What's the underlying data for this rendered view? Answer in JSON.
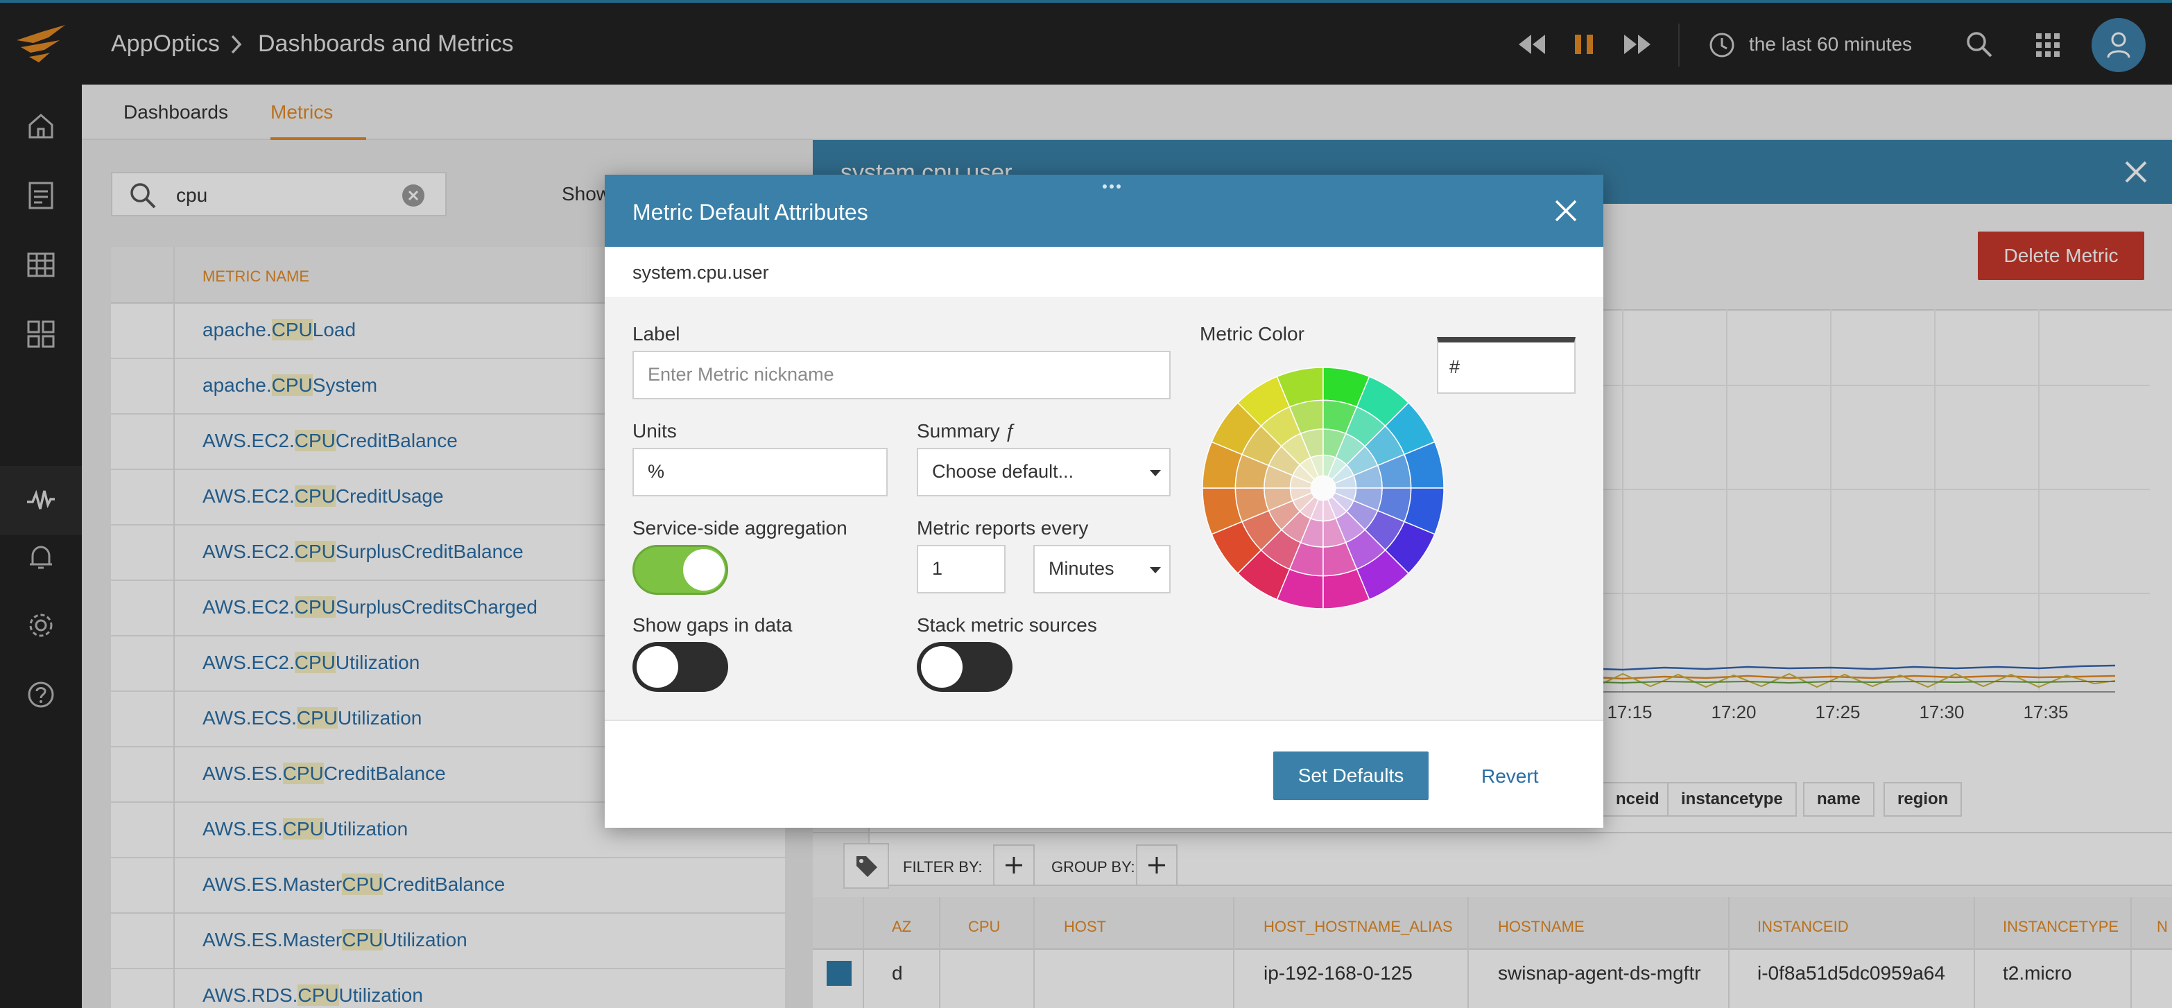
{
  "header": {
    "app_name": "AppOptics",
    "page_title": "Dashboards and Metrics",
    "time_range": "the last 60 minutes"
  },
  "subnav": {
    "tabs": [
      {
        "label": "Dashboards",
        "active": false
      },
      {
        "label": "Metrics",
        "active": true
      }
    ]
  },
  "search": {
    "value": "cpu",
    "show_label": "Show"
  },
  "metrics_table": {
    "column_header": "METRIC NAME",
    "rows": [
      {
        "prefix": "apache.",
        "match": "CPU",
        "suffix": "Load"
      },
      {
        "prefix": "apache.",
        "match": "CPU",
        "suffix": "System"
      },
      {
        "prefix": "AWS.EC2.",
        "match": "CPU",
        "suffix": "CreditBalance"
      },
      {
        "prefix": "AWS.EC2.",
        "match": "CPU",
        "suffix": "CreditUsage"
      },
      {
        "prefix": "AWS.EC2.",
        "match": "CPU",
        "suffix": "SurplusCreditBalance"
      },
      {
        "prefix": "AWS.EC2.",
        "match": "CPU",
        "suffix": "SurplusCreditsCharged"
      },
      {
        "prefix": "AWS.EC2.",
        "match": "CPU",
        "suffix": "Utilization"
      },
      {
        "prefix": "AWS.ECS.",
        "match": "CPU",
        "suffix": "Utilization"
      },
      {
        "prefix": "AWS.ES.",
        "match": "CPU",
        "suffix": "CreditBalance"
      },
      {
        "prefix": "AWS.ES.",
        "match": "CPU",
        "suffix": "Utilization"
      },
      {
        "prefix": "AWS.ES.Master",
        "match": "CPU",
        "suffix": "CreditBalance"
      },
      {
        "prefix": "AWS.ES.Master",
        "match": "CPU",
        "suffix": "Utilization"
      },
      {
        "prefix": "AWS.RDS.",
        "match": "CPU",
        "suffix": "Utilization"
      }
    ]
  },
  "detail_panel": {
    "title": "system.cpu.user",
    "delete_label": "Delete Metric",
    "chart_x_ticks": [
      "17:15",
      "17:20",
      "17:25",
      "17:30",
      "17:35"
    ],
    "tags": [
      "nceid",
      "instancetype",
      "name",
      "region"
    ],
    "filter_label": "FILTER BY:",
    "group_label": "GROUP BY:",
    "source_columns": [
      "AZ",
      "CPU",
      "HOST",
      "HOST_HOSTNAME_ALIAS",
      "HOSTNAME",
      "INSTANCEID",
      "INSTANCETYPE",
      "N"
    ],
    "source_row": {
      "az": "d",
      "cpu": "",
      "host": "",
      "host_hostname_alias": "ip-192-168-0-125",
      "hostname": "swisnap-agent-ds-mgftr",
      "instanceid": "i-0f8a51d5dc0959a64",
      "instancetype": "t2.micro",
      "color": "#2f7aa8"
    }
  },
  "modal": {
    "title": "Metric Default Attributes",
    "metric_name": "system.cpu.user",
    "label_field": {
      "label": "Label",
      "placeholder": "Enter Metric nickname",
      "value": ""
    },
    "units_field": {
      "label": "Units",
      "value": "%"
    },
    "summary_field": {
      "label": "Summary ƒ",
      "value": "Choose default..."
    },
    "aggregation": {
      "label": "Service-side aggregation",
      "on": true
    },
    "reports_every": {
      "label": "Metric reports every",
      "value": "1",
      "unit": "Minutes"
    },
    "show_gaps": {
      "label": "Show gaps in data",
      "on": false
    },
    "stack_sources": {
      "label": "Stack metric sources",
      "on": false
    },
    "color": {
      "label": "Metric Color",
      "hex_value": "#"
    },
    "buttons": {
      "set_defaults": "Set Defaults",
      "revert": "Revert"
    }
  },
  "colors": {
    "accent": "#3a80a8",
    "highlight": "#e38a25",
    "danger": "#c8392b",
    "toggle_on": "#7dc243",
    "sidebar": "#232323"
  },
  "icons": {
    "topbar": [
      "logo-icon",
      "rewind-icon",
      "pause-icon",
      "fast-forward-icon",
      "clock-icon",
      "search-icon",
      "apps-grid-icon",
      "user-icon"
    ],
    "sidebar": [
      "home-icon",
      "document-icon",
      "table-icon",
      "dashboard-icon",
      "metrics-icon",
      "bell-icon",
      "gear-icon",
      "help-icon"
    ]
  }
}
